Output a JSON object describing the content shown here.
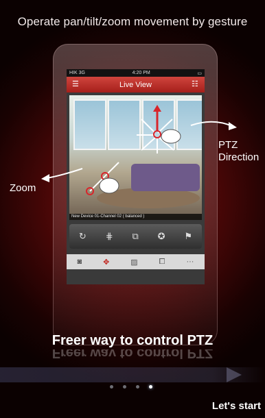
{
  "header": {
    "title": "Operate pan/tilt/zoom movement by gesture"
  },
  "phone": {
    "status": {
      "carrier": "HIK 3G",
      "time": "4:20 PM"
    },
    "nav": {
      "title": "Live View",
      "menu_icon": "hamburger-icon",
      "list_icon": "list-icon"
    },
    "video_caption": "New Device 01-Channel 02 ( balanced )",
    "controls": [
      "refresh-icon",
      "grid-icon",
      "windows-icon",
      "aperture-icon",
      "flag-icon"
    ],
    "toolbar": [
      "camera-icon",
      "ptz-icon",
      "image-icon",
      "record-icon",
      "more-icon"
    ],
    "toolbar_more": "···"
  },
  "annotations": {
    "ptz": "PTZ\nDirection",
    "ptz_line1": "PTZ",
    "ptz_line2": "Direction",
    "zoom": "Zoom"
  },
  "headline": "Freer way to control PTZ",
  "pager": {
    "count": 4,
    "active": 3
  },
  "action": {
    "start": "Let's start"
  },
  "colors": {
    "accent": "#c0211a",
    "background": "#4a0707"
  }
}
